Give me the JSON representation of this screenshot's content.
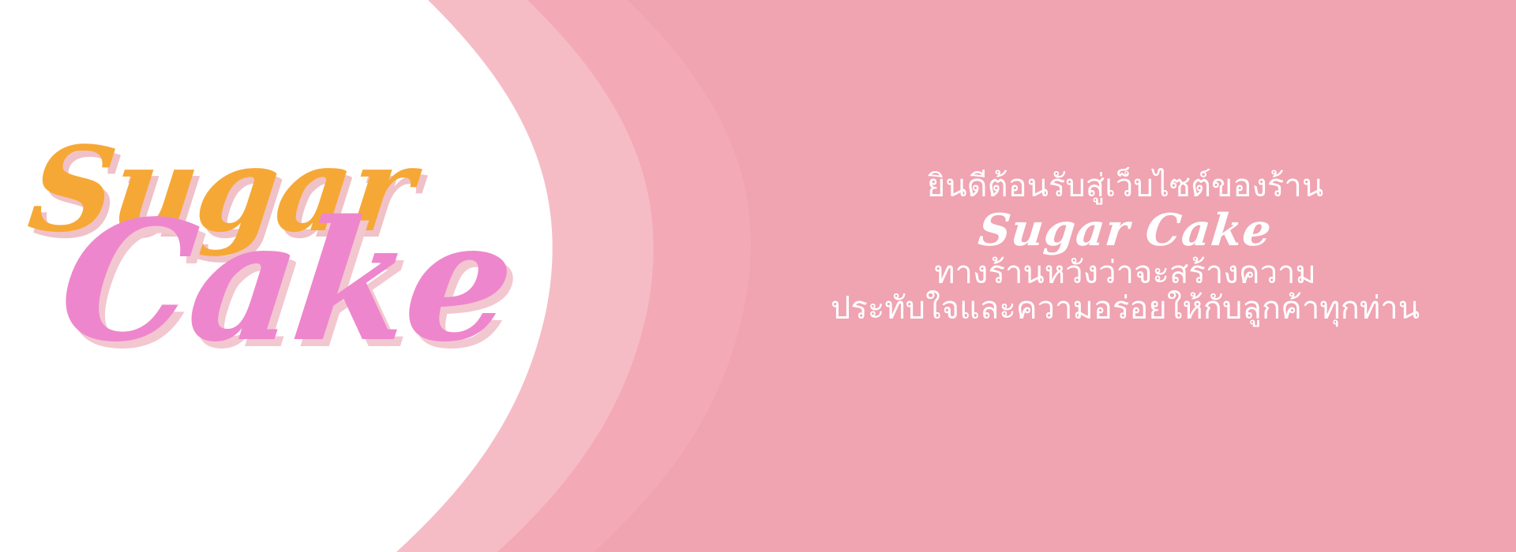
{
  "colors": {
    "background_pink": "#f0a3b1",
    "middle_pink": "#f4a9b6",
    "light_pink": "#f6bcc6",
    "white": "#ffffff",
    "logo_orange": "#f6a836",
    "logo_pink": "#ee86cd",
    "text_white": "#ffffff"
  },
  "logo": {
    "top_word": "Sugar",
    "bottom_word": "Cake"
  },
  "message": {
    "line1": "ยินดีต้อนรับสู่เว็บไซต์ของร้าน",
    "brand": "Sugar Cake",
    "line3": "ทางร้านหวังว่าจะสร้างความ",
    "line4": "ประทับใจและความอร่อยให้กับลูกค้าทุกท่าน"
  }
}
